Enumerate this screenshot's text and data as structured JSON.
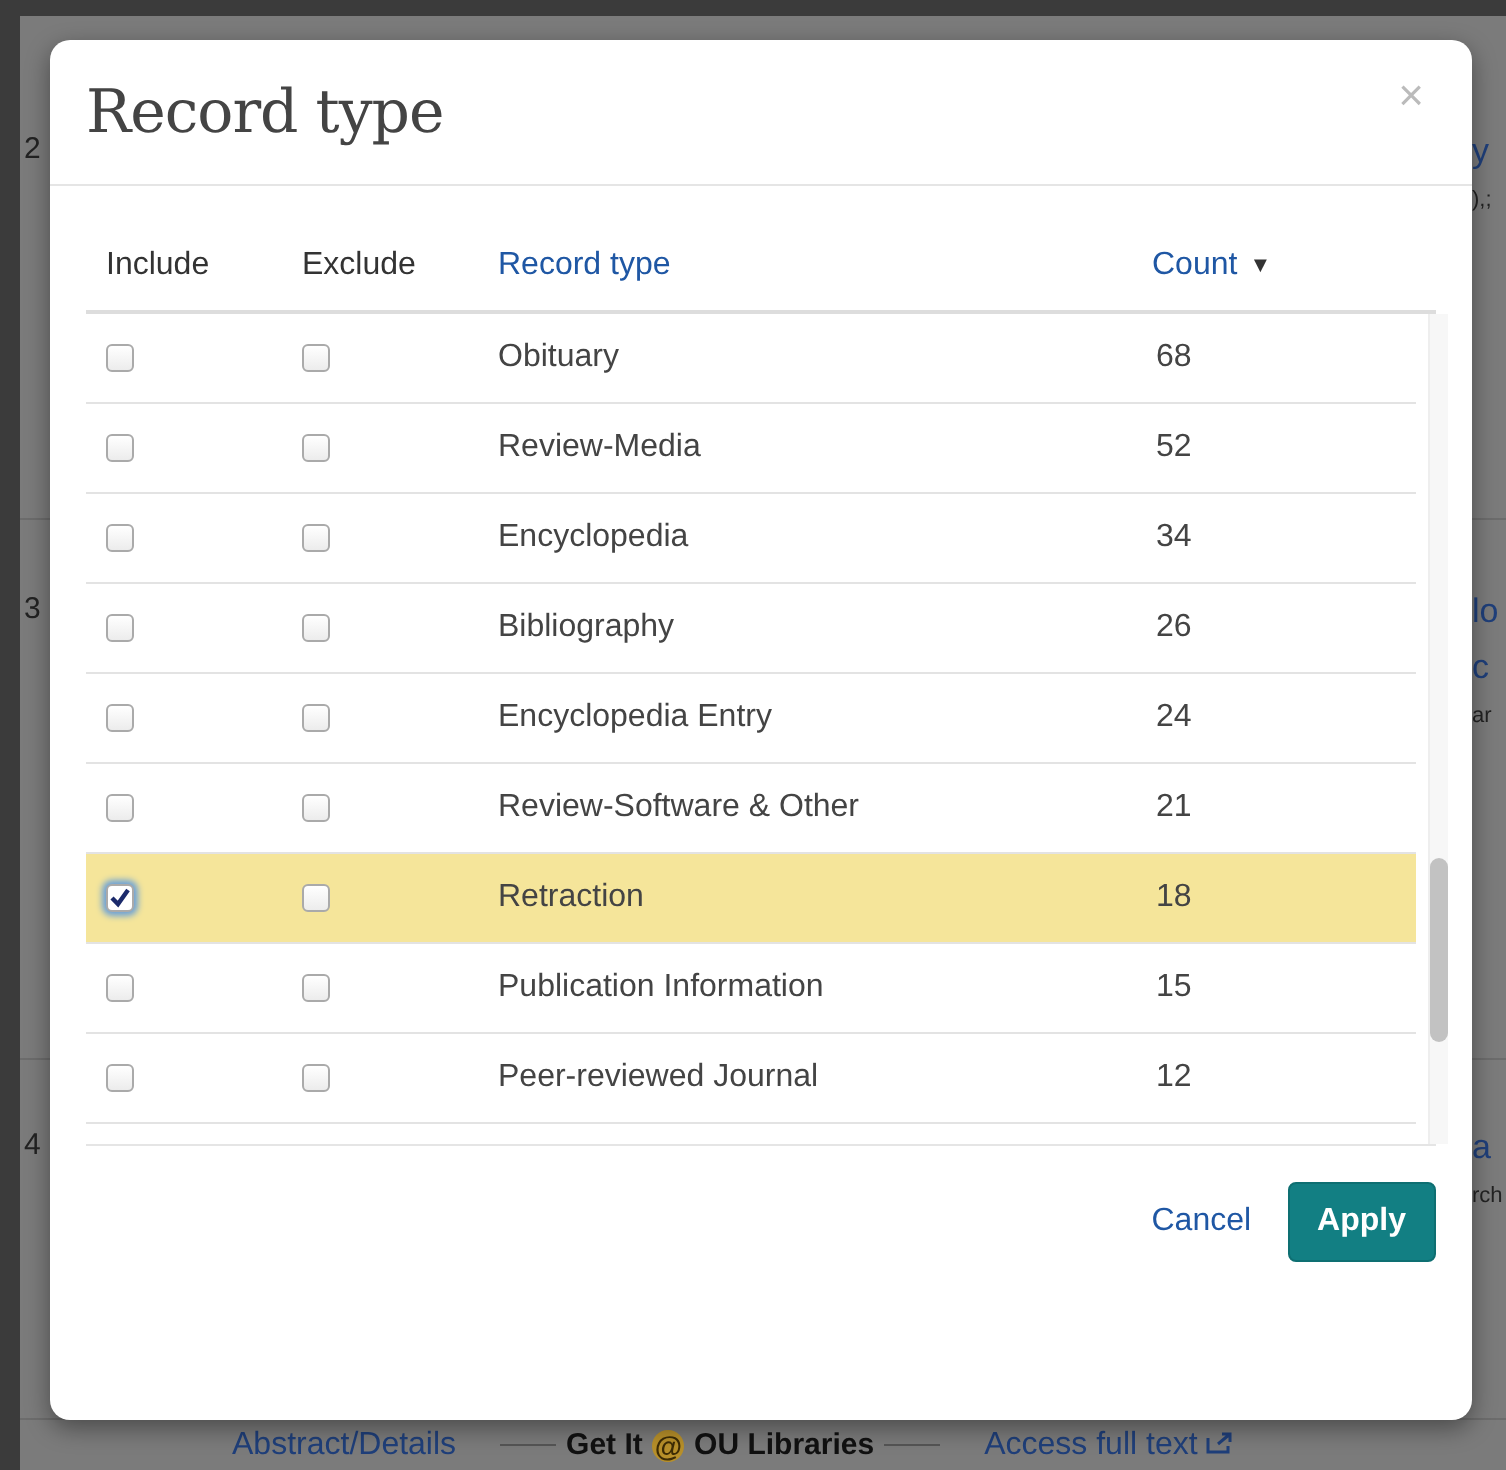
{
  "background": {
    "results": [
      {
        "number": "2",
        "fragments": [
          "y",
          "),;"
        ]
      },
      {
        "number": "3",
        "fragments": [
          "lo",
          "c",
          "ar"
        ]
      },
      {
        "number": "4",
        "fragments": [
          "a",
          "rch"
        ]
      }
    ],
    "links": {
      "abstract": "Abstract/Details",
      "get_it_before": "Get It",
      "get_it_at": "@",
      "get_it_after": "OU Libraries",
      "full_text": "Access full text"
    }
  },
  "dialog": {
    "title": "Record type",
    "close": "×",
    "columns": {
      "include": "Include",
      "exclude": "Exclude",
      "record_type": "Record type",
      "count": "Count",
      "sort": "▼"
    },
    "rows": [
      {
        "name": "Obituary",
        "count": "68",
        "include": false,
        "exclude": false
      },
      {
        "name": "Review-Media",
        "count": "52",
        "include": false,
        "exclude": false
      },
      {
        "name": "Encyclopedia",
        "count": "34",
        "include": false,
        "exclude": false
      },
      {
        "name": "Bibliography",
        "count": "26",
        "include": false,
        "exclude": false
      },
      {
        "name": "Encyclopedia Entry",
        "count": "24",
        "include": false,
        "exclude": false
      },
      {
        "name": "Review-Software & Other",
        "count": "21",
        "include": false,
        "exclude": false
      },
      {
        "name": "Retraction",
        "count": "18",
        "include": true,
        "exclude": false
      },
      {
        "name": "Publication Information",
        "count": "15",
        "include": false,
        "exclude": false
      },
      {
        "name": "Peer-reviewed Journal",
        "count": "12",
        "include": false,
        "exclude": false
      }
    ],
    "buttons": {
      "cancel": "Cancel",
      "apply": "Apply"
    }
  }
}
